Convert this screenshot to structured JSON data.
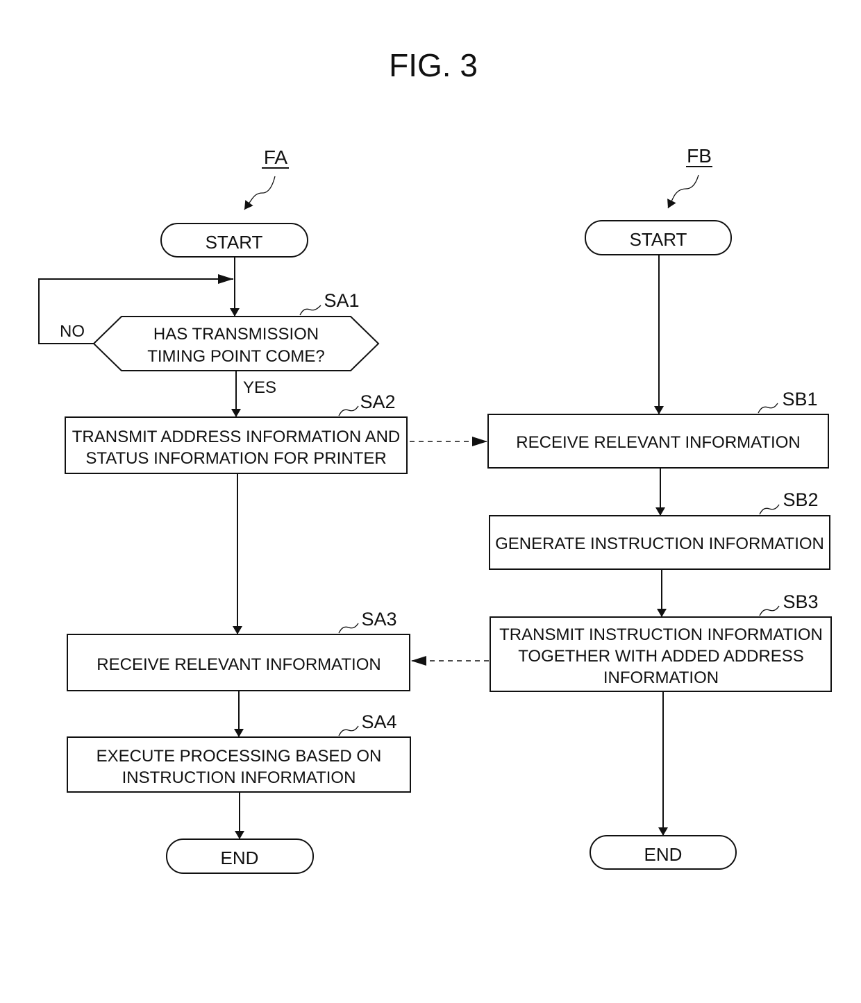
{
  "figure": {
    "title": "FIG. 3"
  },
  "flows": {
    "fa": {
      "label": "FA",
      "start": "START",
      "end": "END",
      "steps": [
        {
          "id": "SA1",
          "type": "decision",
          "lines": [
            "HAS TRANSMISSION",
            "TIMING POINT COME?"
          ],
          "yes_label": "YES",
          "no_label": "NO"
        },
        {
          "id": "SA2",
          "type": "process",
          "lines": [
            "TRANSMIT ADDRESS INFORMATION AND",
            "STATUS INFORMATION FOR PRINTER"
          ]
        },
        {
          "id": "SA3",
          "type": "process",
          "lines": [
            "RECEIVE RELEVANT INFORMATION"
          ]
        },
        {
          "id": "SA4",
          "type": "process",
          "lines": [
            "EXECUTE PROCESSING BASED ON",
            "INSTRUCTION INFORMATION"
          ]
        }
      ]
    },
    "fb": {
      "label": "FB",
      "start": "START",
      "end": "END",
      "steps": [
        {
          "id": "SB1",
          "type": "process",
          "lines": [
            "RECEIVE RELEVANT INFORMATION"
          ]
        },
        {
          "id": "SB2",
          "type": "process",
          "lines": [
            "GENERATE INSTRUCTION INFORMATION"
          ]
        },
        {
          "id": "SB3",
          "type": "process",
          "lines": [
            "TRANSMIT INSTRUCTION INFORMATION",
            "TOGETHER WITH ADDED ADDRESS",
            "INFORMATION"
          ]
        }
      ]
    }
  },
  "connections": [
    {
      "from": "SA2",
      "to": "SB1",
      "style": "dashed"
    },
    {
      "from": "SB3",
      "to": "SA3",
      "style": "dashed"
    }
  ]
}
